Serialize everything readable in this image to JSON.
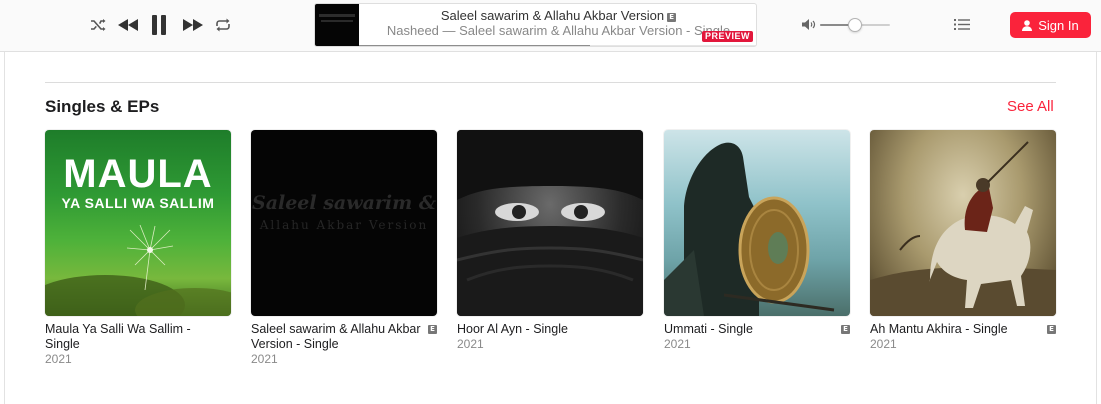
{
  "player": {
    "now_playing_title": "Saleel sawarim & Allahu Akbar Version",
    "explicit_badge": "E",
    "now_playing_subtitle": "Nasheed —  Saleel sawarim & Allahu Akbar Version - Single",
    "preview_label": "PREVIEW",
    "progress_fraction": 0.58,
    "volume_fraction": 0.5,
    "controls": [
      "shuffle-icon",
      "previous-icon",
      "pause-icon",
      "next-icon",
      "repeat-icon"
    ],
    "volume_icon": "speaker-icon",
    "queue_icon": "list-icon"
  },
  "auth": {
    "sign_in_label": "Sign In",
    "icon": "person-icon"
  },
  "section": {
    "title": "Singles & EPs",
    "see_all_label": "See All",
    "items": [
      {
        "title": "Maula Ya Salli Wa Sallim - Single",
        "year": "2021",
        "explicit": false,
        "art_text_1": "MAULA",
        "art_text_2": "YA SALLI WA SALLIM"
      },
      {
        "title": "Saleel sawarim & Allahu Akbar Version - Single",
        "year": "2021",
        "explicit": true,
        "art_text_1": "Saleel sawarim &",
        "art_text_2": "Allahu Akbar Version"
      },
      {
        "title": "Hoor Al Ayn - Single",
        "year": "2021",
        "explicit": false
      },
      {
        "title": "Ummati - Single",
        "year": "2021",
        "explicit": true
      },
      {
        "title": "Ah Mantu Akhira - Single",
        "year": "2021",
        "explicit": true
      }
    ]
  },
  "colors": {
    "accent": "#fa233b",
    "preview_badge": "#e2173b"
  }
}
